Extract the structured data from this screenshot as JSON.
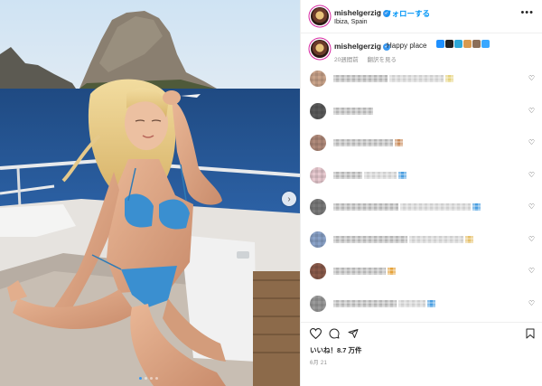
{
  "post": {
    "username": "mishelgerzig",
    "separator": "•",
    "follow_label": "フォローする",
    "location": "Ibiza, Spain",
    "caption_text": "Happy place",
    "caption_emoji_colors": [
      "#1e90ff",
      "#222222",
      "#2ea8d8",
      "#d99a4e",
      "#8b6f5a",
      "#3aa8ff"
    ],
    "time_ago": "20週間前",
    "translate_label": "翻訳を見る",
    "more_icon": "more-horizontal-icon",
    "likes_text": "いいね！8.7 万件",
    "date_text": "6月 21",
    "next_icon": "chevron-right-icon",
    "carousel_dots": 4,
    "carousel_active": 0
  },
  "comments": [
    {
      "avatar_color": "#c9a38a",
      "name_width": 60,
      "text_width": 60,
      "emoji_color": "#e5d27c"
    },
    {
      "avatar_color": "#5a5a5a",
      "name_width": 44,
      "text_width": 0,
      "emoji_color": ""
    },
    {
      "avatar_color": "#b08a7a",
      "name_width": 66,
      "text_width": 0,
      "emoji_color": "#c98b5a"
    },
    {
      "avatar_color": "#e7c9cf",
      "name_width": 32,
      "text_width": 36,
      "emoji_color": "#4a9ee0"
    },
    {
      "avatar_color": "#7a7a7a",
      "name_width": 72,
      "text_width": 78,
      "emoji_color": "#4a9ee0"
    },
    {
      "avatar_color": "#8aa2c8",
      "name_width": 82,
      "text_width": 60,
      "emoji_color": "#e5c06a"
    },
    {
      "avatar_color": "#8a5a4a",
      "name_width": 58,
      "text_width": 0,
      "emoji_color": "#e5a23a"
    },
    {
      "avatar_color": "#9a9a9a",
      "name_width": 70,
      "text_width": 30,
      "emoji_color": "#4a9ee0"
    }
  ],
  "colors": {
    "accent": "#0095f6",
    "verified": "#3897f0",
    "text": "#262626",
    "muted": "#8e8e8e"
  }
}
